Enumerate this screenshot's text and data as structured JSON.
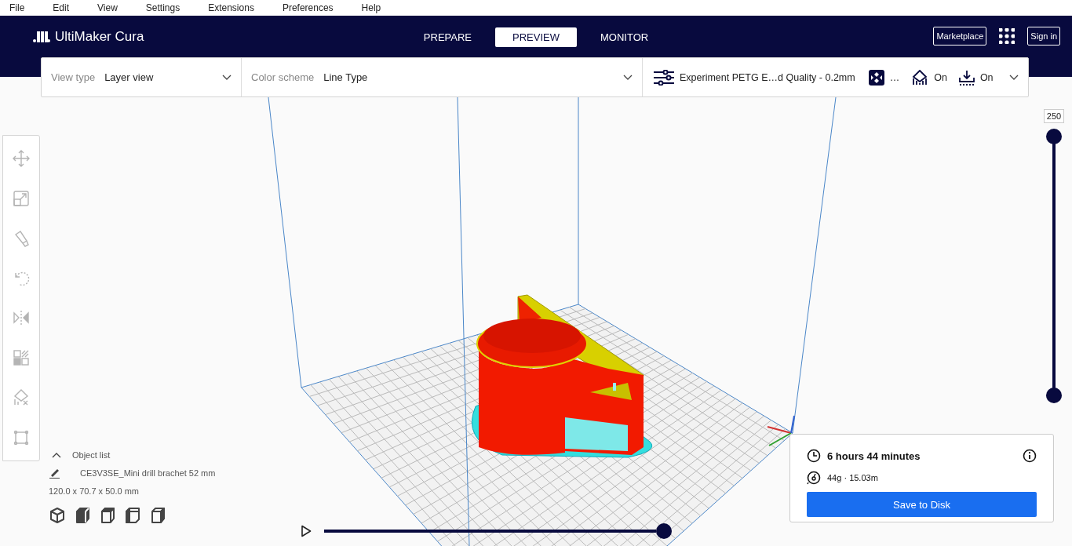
{
  "menu_bar": [
    "File",
    "Edit",
    "View",
    "Settings",
    "Extensions",
    "Preferences",
    "Help"
  ],
  "header": {
    "logo": "UltiMaker Cura",
    "tabs": [
      {
        "label": "PREPARE",
        "selected": false
      },
      {
        "label": "PREVIEW",
        "selected": true
      },
      {
        "label": "MONITOR",
        "selected": false
      }
    ],
    "marketplace": "Marketplace",
    "sign_in": "Sign in"
  },
  "view_toolbar": {
    "view_type": {
      "label": "View type",
      "value": "Layer view"
    },
    "color_scheme": {
      "label": "Color scheme",
      "value": "Line Type"
    },
    "print_setup": {
      "profile": "Experiment PETG E…d Quality - 0.2mm",
      "infill": "…",
      "support": "On",
      "adhesion": "On"
    }
  },
  "tools": [
    {
      "kind": "move",
      "disabled": true
    },
    {
      "kind": "scale",
      "disabled": true
    },
    {
      "kind": "paint",
      "disabled": true
    },
    {
      "kind": "rotate",
      "disabled": true
    },
    {
      "kind": "mirror",
      "disabled": true
    },
    {
      "kind": "per-model",
      "disabled": true
    },
    {
      "kind": "support-blocker",
      "disabled": true
    },
    {
      "kind": "bounds",
      "disabled": true
    }
  ],
  "object_list": {
    "title": "Object list",
    "expanded": true,
    "object_name": "CE3V3SE_Mini drill brachet 52 mm",
    "dimensions": "120.0 x 70.7 x 50.0 mm"
  },
  "layer_slider": {
    "value": "250",
    "handles": [
      {
        "level": 1
      },
      {
        "level": 0
      }
    ]
  },
  "path_slider": {
    "level": 1
  },
  "print_info": {
    "time": "6 hours 44 minutes",
    "material": "44g · 15.03m",
    "button": "Save to Disk"
  }
}
